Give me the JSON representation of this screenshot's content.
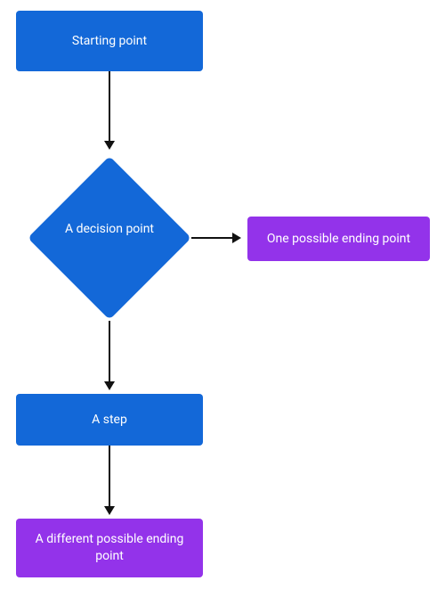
{
  "chart_data": {
    "type": "flowchart",
    "nodes": [
      {
        "id": "start",
        "label": "Starting point",
        "shape": "rect",
        "color": "#1368d8"
      },
      {
        "id": "decision",
        "label": "A decision point",
        "shape": "diamond",
        "color": "#1368d8"
      },
      {
        "id": "end1",
        "label": "One possible ending point",
        "shape": "rect",
        "color": "#9333ea"
      },
      {
        "id": "step",
        "label": "A step",
        "shape": "rect",
        "color": "#1368d8"
      },
      {
        "id": "end2",
        "label": "A different possible ending point",
        "shape": "rect",
        "color": "#9333ea"
      }
    ],
    "edges": [
      {
        "from": "start",
        "to": "decision",
        "direction": "down"
      },
      {
        "from": "decision",
        "to": "end1",
        "direction": "right"
      },
      {
        "from": "decision",
        "to": "step",
        "direction": "down"
      },
      {
        "from": "step",
        "to": "end2",
        "direction": "down"
      }
    ]
  }
}
